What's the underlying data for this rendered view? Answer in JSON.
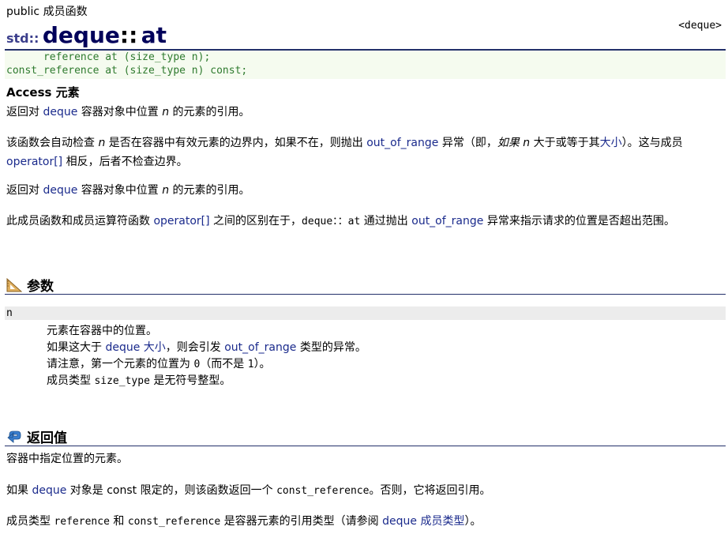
{
  "header": {
    "kind": "public 成员函数",
    "ns": "std::",
    "class_name": "deque",
    "sep": "::",
    "method": "at",
    "header_link": "<deque>"
  },
  "prototypes": [
    "      reference at (size_type n);",
    "const_reference at (size_type n) const;"
  ],
  "access_title": "Access 元素",
  "para1": {
    "a": "返回对 ",
    "b": "deque",
    "c": " 容器对象中位置 ",
    "d": "n",
    "e": " 的元素的引用。"
  },
  "para2": {
    "a": "该函数会自动检查 ",
    "b": "n",
    "c": " 是否在容器中有效元素的边界内，如果不在，则抛出 ",
    "d": "out_of_range",
    "e": " 异常（即，",
    "f": "如果 n",
    "g": " 大于或等于其",
    "h": "大小",
    "i": "）。这与成员 ",
    "j": "operator[]",
    "k": " 相反，后者不检查边界。"
  },
  "para3": {
    "a": "返回对 ",
    "b": "deque",
    "c": " 容器对象中位置 ",
    "d": "n",
    "e": " 的元素的引用。"
  },
  "para4": {
    "a": "此成员函数和成员运算符函数 ",
    "b": "operator[]",
    "c": " 之间的区别在于，",
    "d": "deque：：at",
    "e": " 通过抛出 ",
    "f": "out_of_range",
    "g": " 异常来指示请求的位置是否超出范围。"
  },
  "params_title": "参数",
  "param": {
    "name": "n",
    "l1": "元素在容器中的位置。",
    "l2a": "如果这大于 ",
    "l2b": "deque",
    "l2c": " ",
    "l2d": "大小",
    "l2e": "，则会引发 ",
    "l2f": "out_of_range",
    "l2g": " 类型的异常。",
    "l3a": "请注意，第一个元素的位置为 ",
    "l3b": "0",
    "l3c": "（而不是 ",
    "l3d": "1",
    "l3e": "）。",
    "l4a": "成员类型 ",
    "l4b": "size_type",
    "l4c": " 是无符号整型。"
  },
  "return_title": "返回值",
  "ret1": "容器中指定位置的元素。",
  "ret2": {
    "a": "如果 ",
    "b": "deque",
    "c": " 对象是 const 限定的，则该函数返回一个 ",
    "d": "const_reference",
    "e": "。否则，它将返回引用。"
  },
  "ret3": {
    "a": "成员类型 ",
    "b": "reference",
    "c": " 和 ",
    "d": "const_reference",
    "e": " 是容器元素的引用类型（请参阅 ",
    "f": "deque 成员类型",
    "g": "）。"
  },
  "colors": {
    "link": "#1a2a8c",
    "rule": "#23306a",
    "proto_text": "#2e7a2e",
    "proto_bg": "#f5fbef",
    "param_bg": "#ececec"
  },
  "icons": {
    "params": "ruler-triangle-icon",
    "return": "return-arrow-icon"
  }
}
